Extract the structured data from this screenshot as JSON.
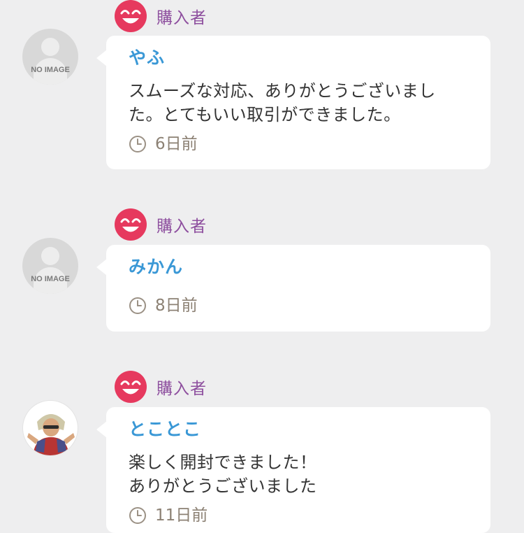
{
  "reviews": [
    {
      "role": "購入者",
      "avatar": "NO IMAGE",
      "username": "やふ",
      "comment": "スムーズな対応、ありがとうございまし\nた。とてもいい取引ができました。",
      "time": "6日前"
    },
    {
      "role": "購入者",
      "avatar": "NO IMAGE",
      "username": "みかん",
      "comment": "",
      "time": "8日前"
    },
    {
      "role": "購入者",
      "avatar": "",
      "username": "とことこ",
      "comment": "楽しく開封できました！\nありがとうございました",
      "time": "11日前"
    }
  ],
  "colors": {
    "background": "#eeeeef",
    "smile_badge": "#e6395e",
    "role_text": "#8d4e9e",
    "username": "#3a98d6",
    "time_text": "#8c8174"
  },
  "icons": [
    "smile-icon",
    "no-image-avatar-icon",
    "clock-icon"
  ]
}
